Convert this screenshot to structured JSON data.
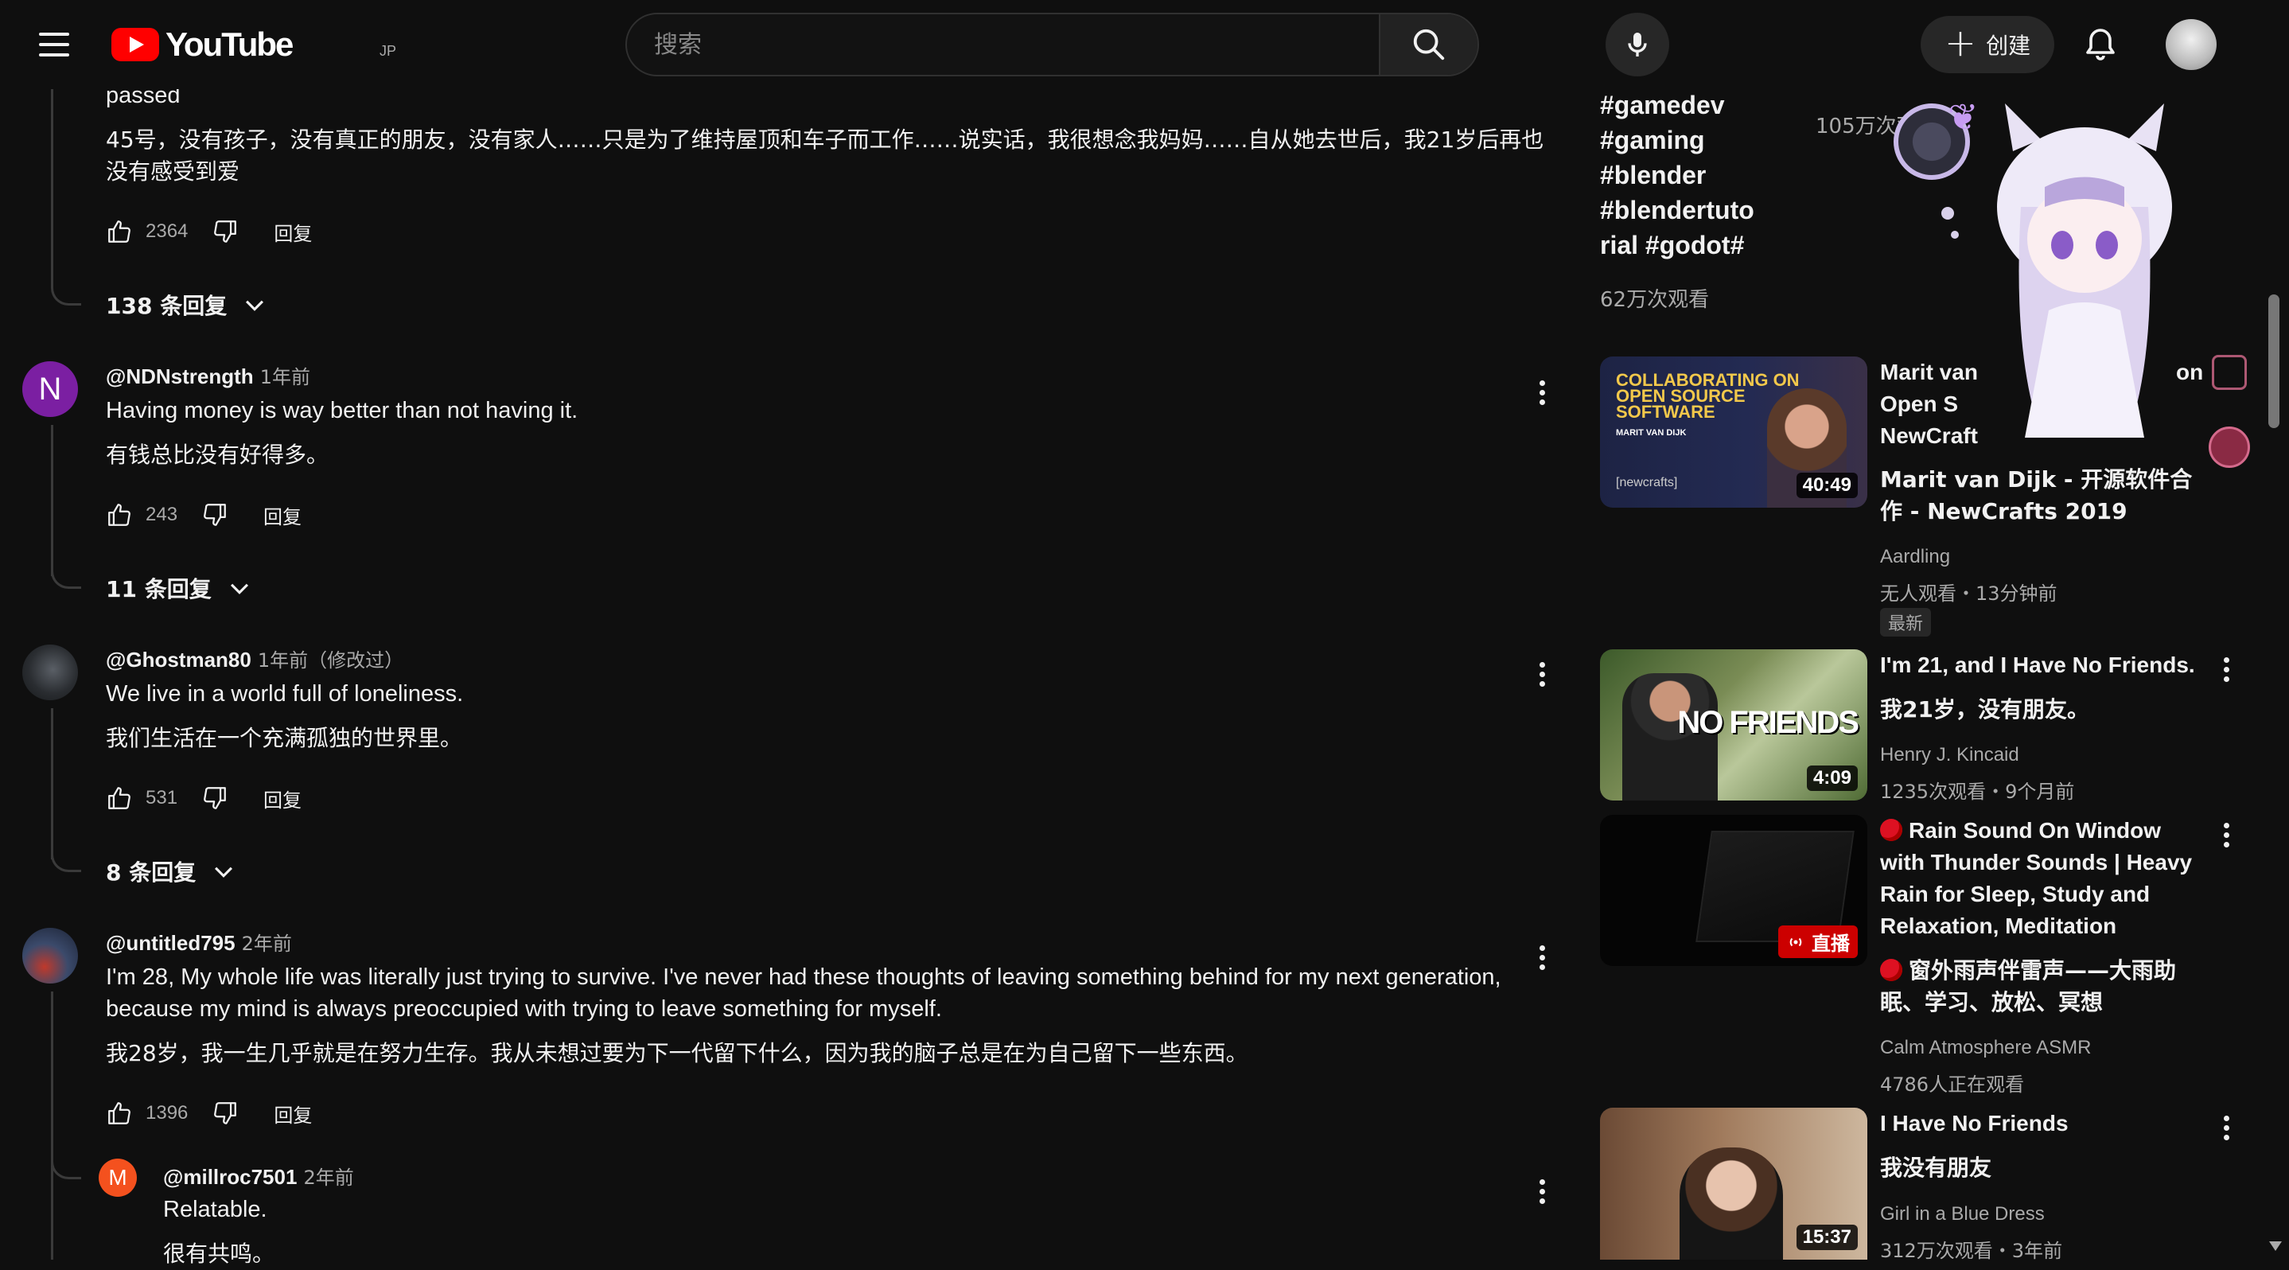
{
  "header": {
    "logo_text": "YouTube",
    "region": "JP",
    "search_placeholder": "搜索",
    "create_label": "创建"
  },
  "comments": {
    "top": {
      "text_en": "passed",
      "text_zh_line1": "45号，没有孩子，没有真正的朋友，没有家人……只是为了维持屋顶和车子而工作……说实话，我很想念我妈妈……自从她去世后，我21岁后再也",
      "text_zh_line2": "没有感受到爱",
      "likes": "2364",
      "reply": "回复",
      "replies_toggle": "138 条回复"
    },
    "c1": {
      "avatar_letter": "N",
      "author": "@NDNstrength",
      "meta": "1年前",
      "text_en": "Having money is way better than not having it.",
      "text_zh": "有钱总比没有好得多。",
      "likes": "243",
      "reply": "回复",
      "replies_toggle": "11 条回复"
    },
    "c2": {
      "author": "@Ghostman80",
      "meta": "1年前（修改过）",
      "text_en": "We live in a world full of loneliness.",
      "text_zh": "我们生活在一个充满孤独的世界里。",
      "likes": "531",
      "reply": "回复",
      "replies_toggle": "8 条回复"
    },
    "c3": {
      "author": "@untitled795",
      "meta": "2年前",
      "text_en_line1": "I'm 28, My whole life was literally just trying to survive. I've never had these thoughts of leaving something behind for my next generation,",
      "text_en_line2": "because my mind is always preoccupied with trying to leave something for myself.",
      "text_zh": "我28岁，我一生几乎就是在努力生存。我从未想过要为下一代留下什么，因为我的脑子总是在为自己留下一些东西。",
      "likes": "1396",
      "reply": "回复"
    },
    "reply1": {
      "avatar_letter": "M",
      "author": "@millroc7501",
      "meta": "2年前",
      "text_en": "Relatable.",
      "text_zh": "很有共鸣。"
    }
  },
  "sidebar": {
    "tags": [
      "#gamedev",
      "#gaming",
      "#blender",
      "#blendertuto",
      "rial #godot#"
    ],
    "views_top": "62万次观看",
    "views_float": "105万次观看",
    "videos": [
      {
        "thumb_line1": "COLLABORATING ON",
        "thumb_line2": "OPEN SOURCE",
        "thumb_line3": "SOFTWARE",
        "thumb_author": "MARIT VAN DIJK",
        "thumb_brand": "[newcrafts]",
        "duration": "40:49",
        "title_en_line1": "Marit van",
        "title_en_line1_tail": "on",
        "title_en_line2": "Open S",
        "title_en_line2_tail": "",
        "title_en_line3": "NewCraft",
        "title_zh": "Marit van Dijk - 开源软件合作 - NewCrafts 2019",
        "channel": "Aardling",
        "stats": "无人观看・13分钟前",
        "badge": "最新"
      },
      {
        "thumb_text": "NO FRIENDS",
        "duration": "4:09",
        "title_en": "I'm 21, and I Have No Friends.",
        "title_zh": "我21岁，没有朋友。",
        "channel": "Henry J. Kincaid",
        "stats": "1235次观看・9个月前"
      },
      {
        "live_label": "直播",
        "title_en": "Rain Sound On Window with Thunder Sounds | Heavy Rain for Sleep, Study and Relaxation, Meditation",
        "title_zh": "窗外雨声伴雷声——大雨助眠、学习、放松、冥想",
        "channel": "Calm Atmosphere ASMR",
        "stats": "4786人正在观看"
      },
      {
        "duration": "15:37",
        "title_en": "I Have No Friends",
        "title_zh": "我没有朋友",
        "channel": "Girl in a Blue Dress",
        "stats": "312万次观看・3年前"
      }
    ]
  },
  "colors": {
    "background": "#0f0f0f",
    "text": "#f1f1f1",
    "secondary": "#aaaaaa",
    "brand_red": "#ff0000",
    "avatar_n": "#7b1fa2",
    "avatar_m": "#f4511e"
  }
}
